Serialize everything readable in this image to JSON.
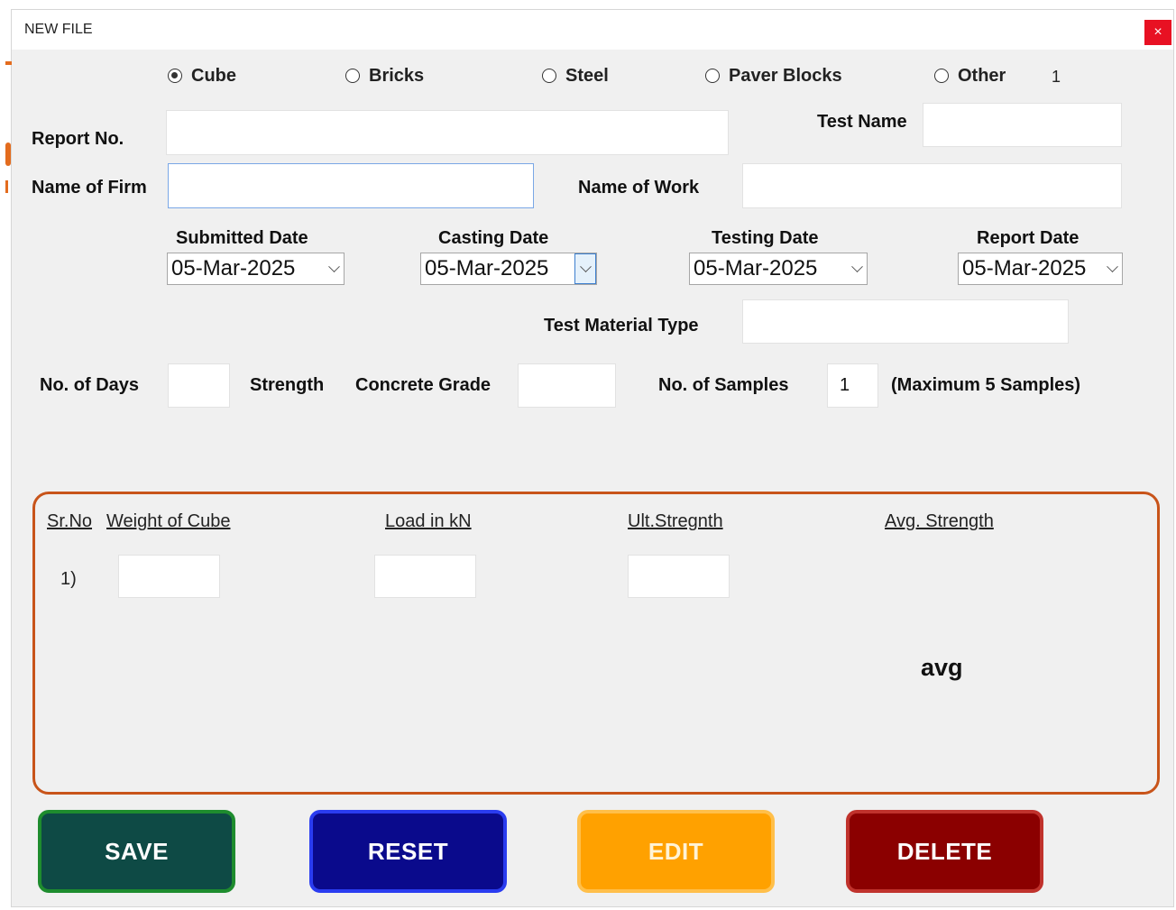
{
  "window": {
    "title": "NEW FILE",
    "close_label": "×"
  },
  "material_options": [
    {
      "label": "Cube",
      "checked": true
    },
    {
      "label": "Bricks",
      "checked": false
    },
    {
      "label": "Steel",
      "checked": false
    },
    {
      "label": "Paver Blocks",
      "checked": false
    },
    {
      "label": "Other",
      "checked": false
    }
  ],
  "counter_label": "1",
  "fields": {
    "report_no": {
      "label": "Report No.",
      "value": ""
    },
    "test_name": {
      "label": "Test Name",
      "value": ""
    },
    "firm_name": {
      "label": "Name of Firm",
      "value": ""
    },
    "work_name": {
      "label": "Name of Work",
      "value": ""
    },
    "test_material_type": {
      "label": "Test Material Type",
      "value": ""
    },
    "no_of_days": {
      "label": "No. of Days",
      "value": ""
    },
    "strength_label": "Strength",
    "concrete_grade": {
      "label": "Concrete Grade",
      "value": ""
    },
    "no_of_samples": {
      "label": "No. of Samples",
      "value": "1"
    },
    "samples_note": "(Maximum 5 Samples)"
  },
  "dates": {
    "submitted": {
      "label": "Submitted Date",
      "value": "05-Mar-2025"
    },
    "casting": {
      "label": "Casting Date",
      "value": "05-Mar-2025"
    },
    "testing": {
      "label": "Testing Date",
      "value": "05-Mar-2025"
    },
    "report": {
      "label": "Report Date",
      "value": "05-Mar-2025"
    }
  },
  "samples_table": {
    "headers": {
      "sr_no": "Sr.No",
      "weight": "Weight of Cube",
      "load": "Load in kN",
      "ult": "Ult.Stregnth",
      "avg": "Avg. Strength"
    },
    "rows": [
      {
        "index": "1)",
        "weight": "",
        "load": "",
        "ult": ""
      }
    ],
    "avg_label": "avg"
  },
  "buttons": {
    "save": "SAVE",
    "reset": "RESET",
    "edit": "EDIT",
    "delete": "DELETE"
  },
  "colors": {
    "panel_border": "#c8541a",
    "save": "#0e4a45",
    "reset": "#0a0a8c",
    "edit": "#ffa100",
    "delete": "#8b0000"
  }
}
